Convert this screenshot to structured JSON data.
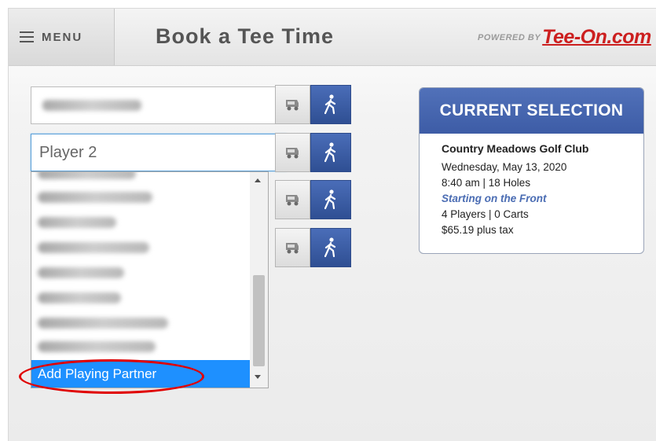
{
  "header": {
    "menu_label": "MENU",
    "title": "Book a Tee Time",
    "powered_by": "POWERED BY",
    "brand": "Tee-On.com"
  },
  "players": {
    "player2_placeholder": "Player 2",
    "dropdown_selected": "Add Playing Partner"
  },
  "selection": {
    "heading": "CURRENT SELECTION",
    "club": "Country Meadows Golf Club",
    "date": "Wednesday, May 13, 2020",
    "time_holes": "8:40 am | 18 Holes",
    "start": "Starting on the Front",
    "players_carts": "4 Players | 0 Carts",
    "price": "$65.19 plus tax"
  },
  "icons": {
    "menu": "hamburger-icon",
    "cart": "golf-cart-icon",
    "walk": "walking-person-icon"
  },
  "colors": {
    "accent_blue": "#3d5ca6",
    "selected_blue": "#1e90ff",
    "brand_red": "#cc1f1f",
    "annotation_red": "#e00000"
  }
}
